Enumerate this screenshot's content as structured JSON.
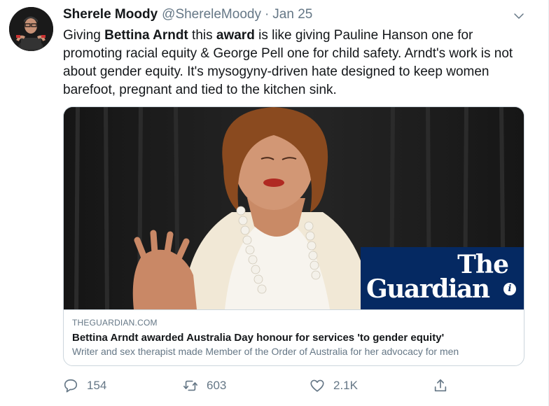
{
  "user": {
    "display_name": "Sherele Moody",
    "handle": "@ShereleMoody",
    "separator": "·",
    "date": "Jan 25"
  },
  "tweet_text": {
    "p1": "Giving ",
    "b1": "Bettina Arndt",
    "p2": " this ",
    "b2": "award",
    "p3": " is like giving Pauline Hanson one for promoting racial equity & George Pell one for child safety. Arndt's work is not about gender equity. It's mysogyny-driven hate designed to keep women barefoot, pregnant and tied to the kitchen sink."
  },
  "card": {
    "domain": "THEGUARDIAN.COM",
    "title": "Bettina Arndt awarded Australia Day honour for services 'to gender equity'",
    "description": "Writer and sex therapist made Member of the Order of Australia for her advocacy for men",
    "logo_line1": "The",
    "logo_line2": "Guardian",
    "logo_info": "i",
    "logo_color": "#052962"
  },
  "actions": {
    "replies": "154",
    "retweets": "603",
    "likes": "2.1K"
  },
  "icons": {
    "reply": "reply-icon",
    "retweet": "retweet-icon",
    "like": "heart-icon",
    "share": "share-icon",
    "menu": "chevron-down-icon"
  }
}
